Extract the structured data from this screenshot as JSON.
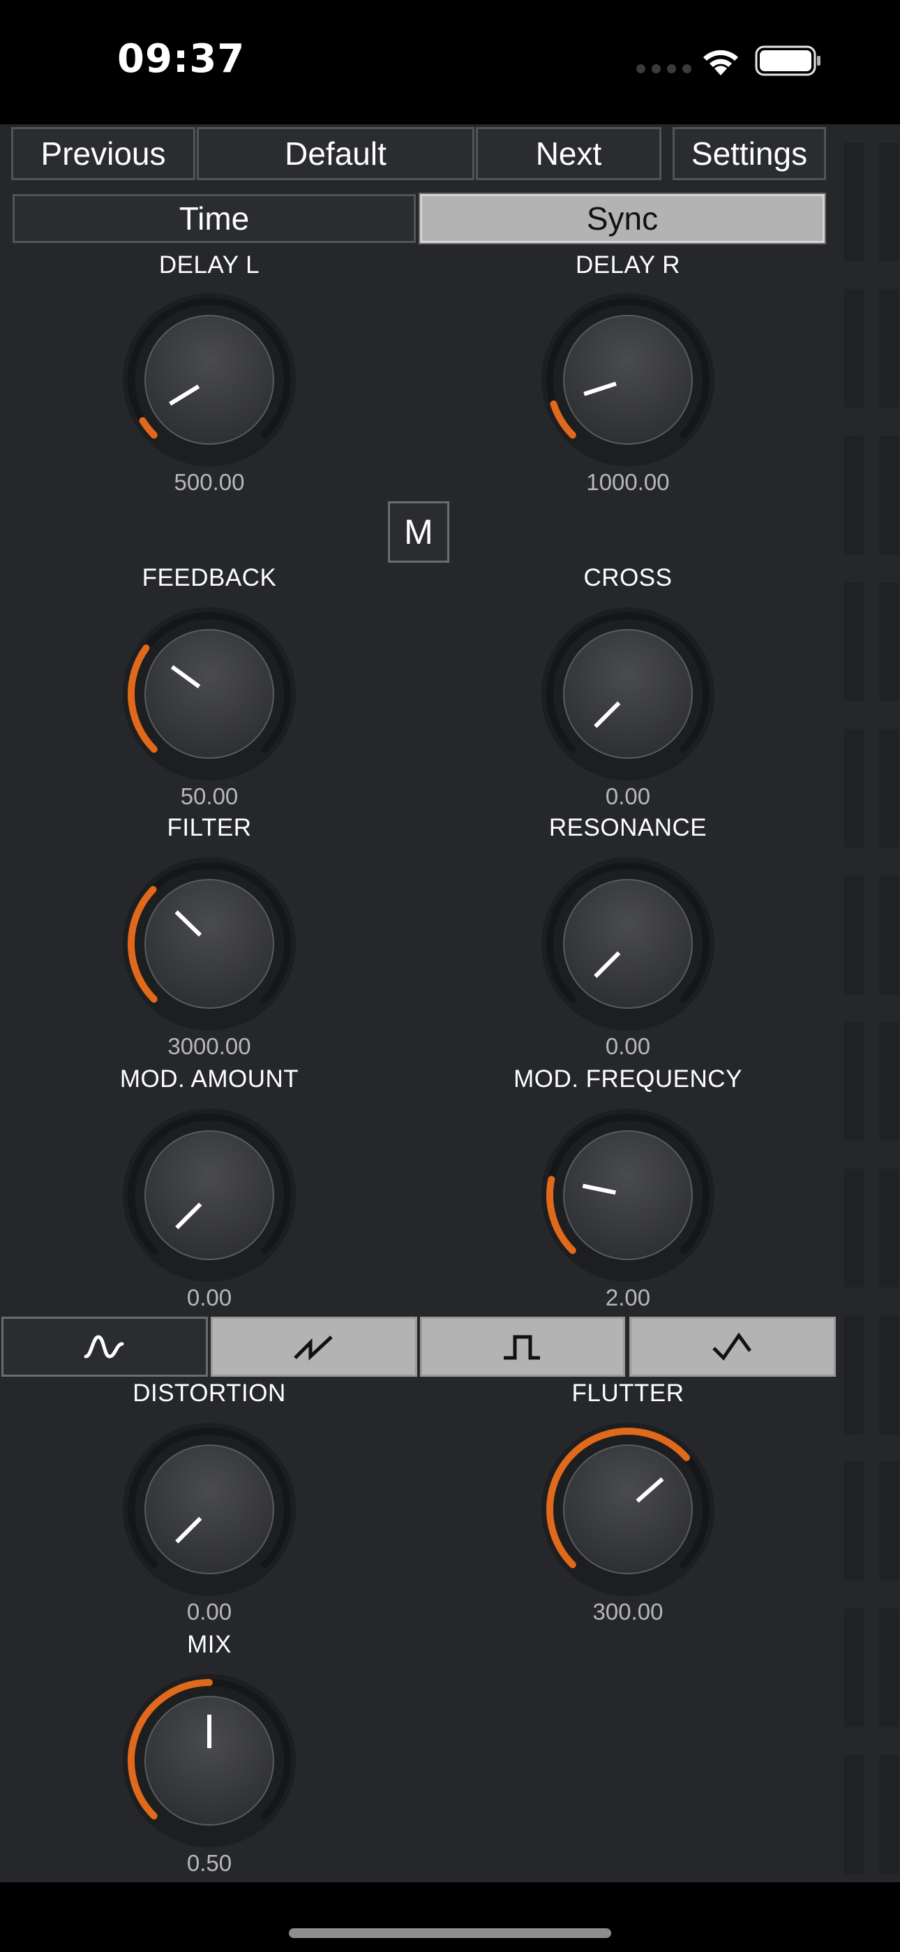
{
  "status": {
    "time": "09:37"
  },
  "nav": {
    "previous": "Previous",
    "default": "Default",
    "next": "Next",
    "settings": "Settings"
  },
  "mode": {
    "time": "Time",
    "sync": "Sync",
    "selected": "Sync"
  },
  "m_button": "M",
  "knobs": {
    "delay_l": {
      "label": "DELAY L",
      "value": "500.00",
      "fraction": 0.05
    },
    "delay_r": {
      "label": "DELAY R",
      "value": "1000.00",
      "fraction": 0.1
    },
    "feedback": {
      "label": "FEEDBACK",
      "value": "50.00",
      "fraction": 0.3
    },
    "cross": {
      "label": "CROSS",
      "value": "0.00",
      "fraction": 0.0
    },
    "filter": {
      "label": "FILTER",
      "value": "3000.00",
      "fraction": 0.33
    },
    "resonance": {
      "label": "RESONANCE",
      "value": "0.00",
      "fraction": 0.0
    },
    "mod_amount": {
      "label": "MOD. AMOUNT",
      "value": "0.00",
      "fraction": 0.0
    },
    "mod_frequency": {
      "label": "MOD. FREQUENCY",
      "value": "2.00",
      "fraction": 0.21
    },
    "distortion": {
      "label": "DISTORTION",
      "value": "0.00",
      "fraction": 0.0
    },
    "flutter": {
      "label": "FLUTTER",
      "value": "300.00",
      "fraction": 0.68
    },
    "mix": {
      "label": "MIX",
      "value": "0.50",
      "fraction": 0.5
    }
  },
  "waveforms": {
    "options": [
      "sine-wave-icon",
      "sawtooth-wave-icon",
      "square-wave-icon",
      "triangle-wave-icon"
    ],
    "selected": "sine-wave-icon"
  },
  "colors": {
    "accent": "#e0691c",
    "panel": "#25272a",
    "pointer": "#ffffff"
  }
}
